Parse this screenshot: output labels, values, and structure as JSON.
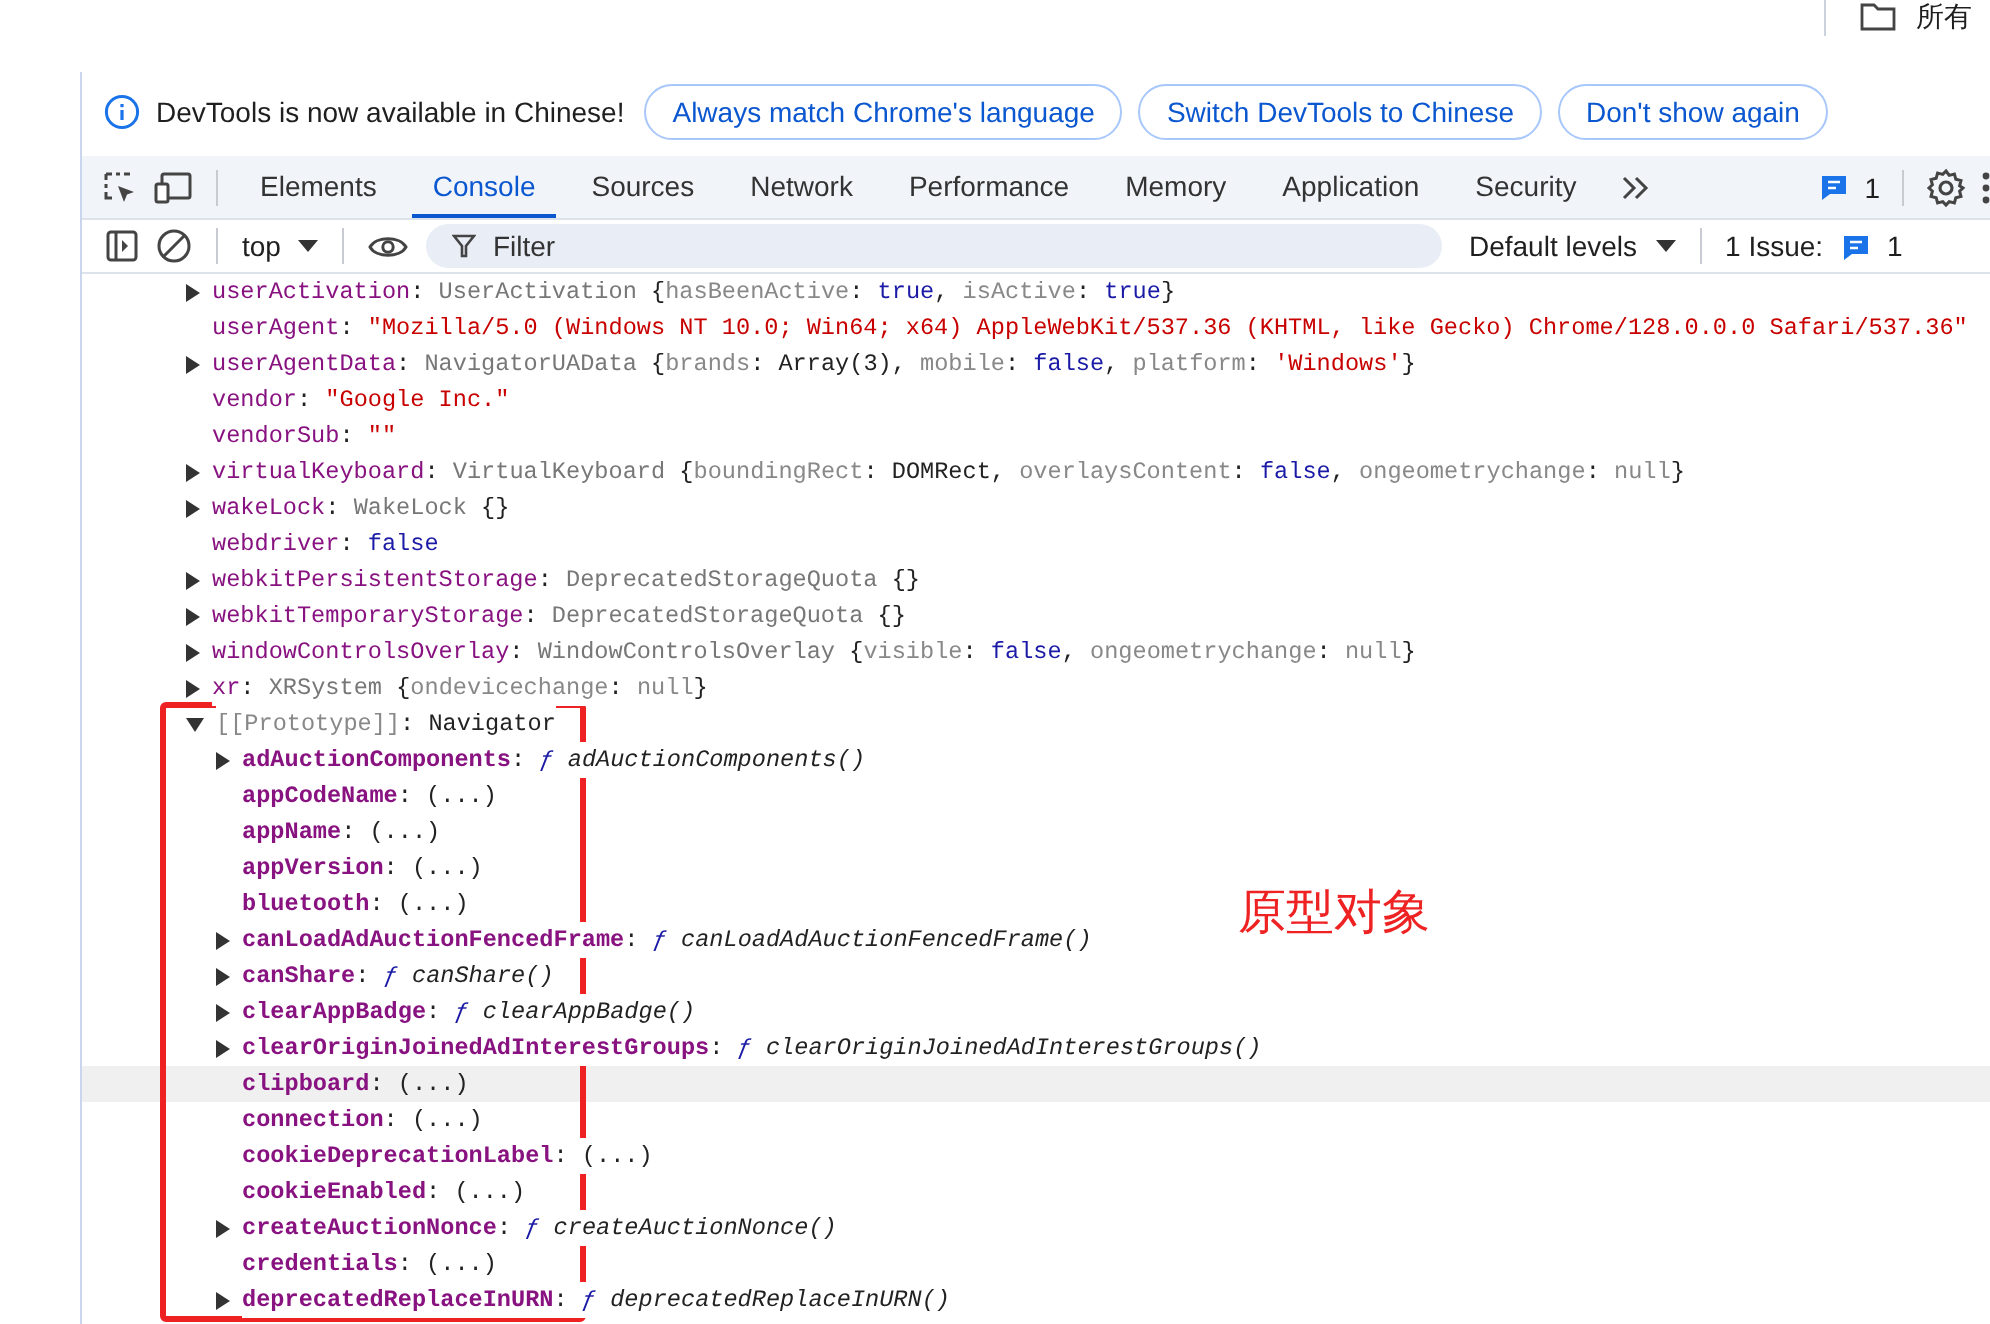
{
  "top_strip": {
    "bookmark": "所有"
  },
  "infobar": {
    "message": "DevTools is now available in Chinese!",
    "buttons": [
      "Always match Chrome's language",
      "Switch DevTools to Chinese",
      "Don't show again"
    ]
  },
  "tabs": [
    {
      "label": "Elements",
      "selected": false
    },
    {
      "label": "Console",
      "selected": true
    },
    {
      "label": "Sources",
      "selected": false
    },
    {
      "label": "Network",
      "selected": false
    },
    {
      "label": "Performance",
      "selected": false
    },
    {
      "label": "Memory",
      "selected": false
    },
    {
      "label": "Application",
      "selected": false
    },
    {
      "label": "Security",
      "selected": false
    }
  ],
  "tab_bar_right": {
    "messages_count": "1"
  },
  "console_toolbar": {
    "context": "top",
    "filter_placeholder": "Filter",
    "levels": "Default levels",
    "issues_label": "1 Issue:",
    "issues_count": "1"
  },
  "console": {
    "lines": [
      {
        "kind": "object",
        "expanded": false,
        "key": "userActivation",
        "parts": [
          {
            "kind": "punct",
            "text": ": "
          },
          {
            "kind": "type",
            "text": "UserActivation  "
          },
          {
            "kind": "punct",
            "text": "{"
          },
          {
            "kind": "prop",
            "text": "hasBeenActive"
          },
          {
            "kind": "punct",
            "text": ": "
          },
          {
            "kind": "keyword",
            "text": "true"
          },
          {
            "kind": "punct",
            "text": ", "
          },
          {
            "kind": "prop",
            "text": "isActive"
          },
          {
            "kind": "punct",
            "text": ": "
          },
          {
            "kind": "keyword",
            "text": "true"
          },
          {
            "kind": "punct",
            "text": "}"
          }
        ]
      },
      {
        "kind": "value",
        "key": "userAgent",
        "parts": [
          {
            "kind": "punct",
            "text": ": "
          },
          {
            "kind": "string",
            "text": "\"Mozilla/5.0 (Windows NT 10.0; Win64; x64) AppleWebKit/537.36 (KHTML, like Gecko) Chrome/128.0.0.0 Safari/537.36\""
          }
        ]
      },
      {
        "kind": "object",
        "expanded": false,
        "key": "userAgentData",
        "parts": [
          {
            "kind": "punct",
            "text": ": "
          },
          {
            "kind": "type",
            "text": "NavigatorUAData  "
          },
          {
            "kind": "punct",
            "text": "{"
          },
          {
            "kind": "prop",
            "text": "brands"
          },
          {
            "kind": "punct",
            "text": ": Array(3), "
          },
          {
            "kind": "prop",
            "text": "mobile"
          },
          {
            "kind": "punct",
            "text": ": "
          },
          {
            "kind": "keyword",
            "text": "false"
          },
          {
            "kind": "punct",
            "text": ", "
          },
          {
            "kind": "prop",
            "text": "platform"
          },
          {
            "kind": "punct",
            "text": ": "
          },
          {
            "kind": "string",
            "text": "'Windows'"
          },
          {
            "kind": "punct",
            "text": "}"
          }
        ]
      },
      {
        "kind": "value",
        "key": "vendor",
        "parts": [
          {
            "kind": "punct",
            "text": ": "
          },
          {
            "kind": "string",
            "text": "\"Google Inc.\""
          }
        ]
      },
      {
        "kind": "value",
        "key": "vendorSub",
        "parts": [
          {
            "kind": "punct",
            "text": ": "
          },
          {
            "kind": "string",
            "text": "\"\""
          }
        ]
      },
      {
        "kind": "object",
        "expanded": false,
        "key": "virtualKeyboard",
        "parts": [
          {
            "kind": "punct",
            "text": ": "
          },
          {
            "kind": "type",
            "text": "VirtualKeyboard  "
          },
          {
            "kind": "punct",
            "text": "{"
          },
          {
            "kind": "prop",
            "text": "boundingRect"
          },
          {
            "kind": "punct",
            "text": ": DOMRect, "
          },
          {
            "kind": "prop",
            "text": "overlaysContent"
          },
          {
            "kind": "punct",
            "text": ": "
          },
          {
            "kind": "keyword",
            "text": "false"
          },
          {
            "kind": "punct",
            "text": ", "
          },
          {
            "kind": "prop",
            "text": "ongeometrychange"
          },
          {
            "kind": "punct",
            "text": ": "
          },
          {
            "kind": "null",
            "text": "null"
          },
          {
            "kind": "punct",
            "text": "}"
          }
        ]
      },
      {
        "kind": "object",
        "expanded": false,
        "key": "wakeLock",
        "parts": [
          {
            "kind": "punct",
            "text": ": "
          },
          {
            "kind": "type",
            "text": "WakeLock  "
          },
          {
            "kind": "punct",
            "text": "{}"
          }
        ]
      },
      {
        "kind": "value",
        "key": "webdriver",
        "parts": [
          {
            "kind": "punct",
            "text": ": "
          },
          {
            "kind": "keyword",
            "text": "false"
          }
        ]
      },
      {
        "kind": "object",
        "expanded": false,
        "key": "webkitPersistentStorage",
        "parts": [
          {
            "kind": "punct",
            "text": ": "
          },
          {
            "kind": "type",
            "text": "DeprecatedStorageQuota  "
          },
          {
            "kind": "punct",
            "text": "{}"
          }
        ]
      },
      {
        "kind": "object",
        "expanded": false,
        "key": "webkitTemporaryStorage",
        "parts": [
          {
            "kind": "punct",
            "text": ": "
          },
          {
            "kind": "type",
            "text": "DeprecatedStorageQuota  "
          },
          {
            "kind": "punct",
            "text": "{}"
          }
        ]
      },
      {
        "kind": "object",
        "expanded": false,
        "key": "windowControlsOverlay",
        "parts": [
          {
            "kind": "punct",
            "text": ": "
          },
          {
            "kind": "type",
            "text": "WindowControlsOverlay  "
          },
          {
            "kind": "punct",
            "text": "{"
          },
          {
            "kind": "prop",
            "text": "visible"
          },
          {
            "kind": "punct",
            "text": ": "
          },
          {
            "kind": "keyword",
            "text": "false"
          },
          {
            "kind": "punct",
            "text": ", "
          },
          {
            "kind": "prop",
            "text": "ongeometrychange"
          },
          {
            "kind": "punct",
            "text": ": "
          },
          {
            "kind": "null",
            "text": "null"
          },
          {
            "kind": "punct",
            "text": "}"
          }
        ]
      },
      {
        "kind": "object",
        "expanded": false,
        "key": "xr",
        "parts": [
          {
            "kind": "punct",
            "text": ": "
          },
          {
            "kind": "type",
            "text": "XRSystem  "
          },
          {
            "kind": "punct",
            "text": "{"
          },
          {
            "kind": "prop",
            "text": "ondevicechange"
          },
          {
            "kind": "punct",
            "text": ": "
          },
          {
            "kind": "null",
            "text": "null"
          },
          {
            "kind": "punct",
            "text": "}"
          }
        ]
      },
      {
        "kind": "prototype",
        "expanded": true,
        "key": "[[Prototype]]",
        "parts": [
          {
            "kind": "punct",
            "text": ": Navigator"
          }
        ],
        "children": [
          {
            "kind": "function",
            "expanded": false,
            "key": "adAuctionComponents",
            "hovered": false,
            "parts": [
              {
                "kind": "punct",
                "text": ": "
              },
              {
                "kind": "fsign",
                "text": "ƒ "
              },
              {
                "kind": "func",
                "text": "adAuctionComponents()"
              }
            ]
          },
          {
            "kind": "value",
            "key": "appCodeName",
            "hovered": false,
            "parts": [
              {
                "kind": "punct",
                "text": ": (...)"
              }
            ]
          },
          {
            "kind": "value",
            "key": "appName",
            "hovered": false,
            "parts": [
              {
                "kind": "punct",
                "text": ": (...)"
              }
            ]
          },
          {
            "kind": "value",
            "key": "appVersion",
            "hovered": false,
            "parts": [
              {
                "kind": "punct",
                "text": ": (...)"
              }
            ]
          },
          {
            "kind": "value",
            "key": "bluetooth",
            "hovered": false,
            "parts": [
              {
                "kind": "punct",
                "text": ": (...)"
              }
            ]
          },
          {
            "kind": "function",
            "expanded": false,
            "key": "canLoadAdAuctionFencedFrame",
            "hovered": false,
            "parts": [
              {
                "kind": "punct",
                "text": ": "
              },
              {
                "kind": "fsign",
                "text": "ƒ "
              },
              {
                "kind": "func",
                "text": "canLoadAdAuctionFencedFrame()"
              }
            ]
          },
          {
            "kind": "function",
            "expanded": false,
            "key": "canShare",
            "hovered": false,
            "parts": [
              {
                "kind": "punct",
                "text": ": "
              },
              {
                "kind": "fsign",
                "text": "ƒ "
              },
              {
                "kind": "func",
                "text": "canShare()"
              }
            ]
          },
          {
            "kind": "function",
            "expanded": false,
            "key": "clearAppBadge",
            "hovered": false,
            "parts": [
              {
                "kind": "punct",
                "text": ": "
              },
              {
                "kind": "fsign",
                "text": "ƒ "
              },
              {
                "kind": "func",
                "text": "clearAppBadge()"
              }
            ]
          },
          {
            "kind": "function",
            "expanded": false,
            "key": "clearOriginJoinedAdInterestGroups",
            "hovered": false,
            "parts": [
              {
                "kind": "punct",
                "text": ": "
              },
              {
                "kind": "fsign",
                "text": "ƒ "
              },
              {
                "kind": "func",
                "text": "clearOriginJoinedAdInterestGroups()"
              }
            ]
          },
          {
            "kind": "value",
            "key": "clipboard",
            "hovered": true,
            "parts": [
              {
                "kind": "punct",
                "text": ": (...)"
              }
            ]
          },
          {
            "kind": "value",
            "key": "connection",
            "hovered": false,
            "parts": [
              {
                "kind": "punct",
                "text": ": (...)"
              }
            ]
          },
          {
            "kind": "value",
            "key": "cookieDeprecationLabel",
            "hovered": false,
            "parts": [
              {
                "kind": "punct",
                "text": ": (...)"
              }
            ]
          },
          {
            "kind": "value",
            "key": "cookieEnabled",
            "hovered": false,
            "parts": [
              {
                "kind": "punct",
                "text": ": (...)"
              }
            ]
          },
          {
            "kind": "function",
            "expanded": false,
            "key": "createAuctionNonce",
            "hovered": false,
            "parts": [
              {
                "kind": "punct",
                "text": ": "
              },
              {
                "kind": "fsign",
                "text": "ƒ "
              },
              {
                "kind": "func",
                "text": "createAuctionNonce()"
              }
            ]
          },
          {
            "kind": "value",
            "key": "credentials",
            "hovered": false,
            "parts": [
              {
                "kind": "punct",
                "text": ": (...)"
              }
            ]
          },
          {
            "kind": "function",
            "expanded": false,
            "key": "deprecatedReplaceInURN",
            "hovered": false,
            "parts": [
              {
                "kind": "punct",
                "text": ": "
              },
              {
                "kind": "fsign",
                "text": "ƒ "
              },
              {
                "kind": "func",
                "text": "deprecatedReplaceInURN()"
              }
            ]
          }
        ]
      }
    ]
  },
  "annotation": {
    "label": "原型对象"
  }
}
